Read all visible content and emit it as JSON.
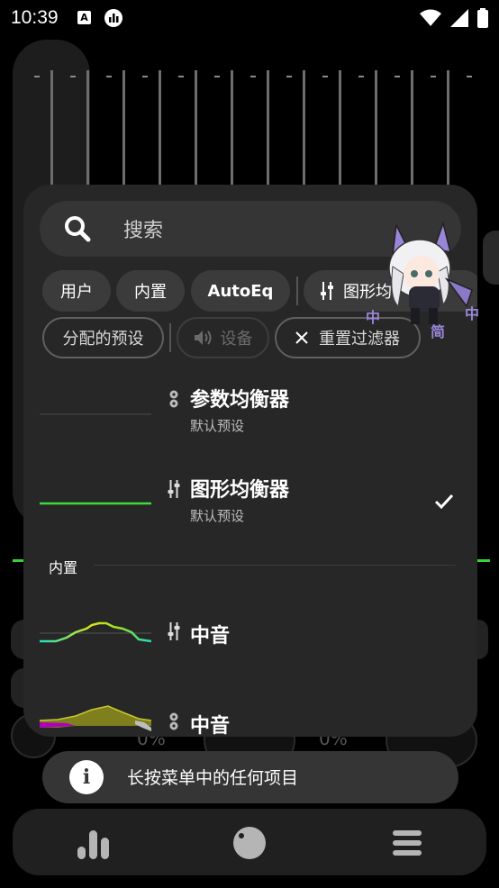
{
  "status_bar": {
    "time": "10:39",
    "notification_icons": [
      "app-a-icon",
      "equalizer-app-icon"
    ],
    "system_icons": [
      "wifi-icon",
      "signal-icon",
      "battery-icon"
    ]
  },
  "background": {
    "percent_left": "0%",
    "percent_right": "0%",
    "accent_color": "#37d23a"
  },
  "sheet": {
    "search": {
      "placeholder": "搜索",
      "icon": "search-icon"
    },
    "filter_chips": [
      {
        "label": "用户"
      },
      {
        "label": "内置"
      },
      {
        "label": "AutoEq"
      },
      {
        "label": "图形均",
        "icon": "graphic-eq-icon"
      },
      {
        "label": "分配的预设"
      },
      {
        "label": "设备",
        "icon": "speaker-icon",
        "disabled": true
      },
      {
        "label": "重置过滤器",
        "icon": "close-icon"
      }
    ],
    "presets": [
      {
        "title": "参数均衡器",
        "subtitle": "默认预设",
        "type_icon": "parametric-eq-icon"
      },
      {
        "title": "图形均衡器",
        "subtitle": "默认预设",
        "type_icon": "graphic-eq-icon",
        "selected": true,
        "check_icon": "checkmark-icon"
      }
    ],
    "builtin_section": {
      "label": "内置",
      "items": [
        {
          "title": "中音",
          "type_icon": "graphic-eq-icon"
        },
        {
          "title": "中音",
          "type_icon": "parametric-eq-icon"
        }
      ]
    }
  },
  "toast": {
    "icon": "info-icon",
    "text": "长按菜单中的任何项目"
  },
  "bottom_nav": {
    "items": [
      {
        "icon": "equalizer-bars-icon"
      },
      {
        "icon": "knob-icon"
      },
      {
        "icon": "menu-icon"
      }
    ]
  },
  "colors": {
    "graph_green": "#3ddc3a",
    "curve_cyan": "#19e0c0",
    "curve_yellow": "#d6e61a",
    "area_olive": "#8a8a1e",
    "area_magenta": "#b000b8"
  }
}
